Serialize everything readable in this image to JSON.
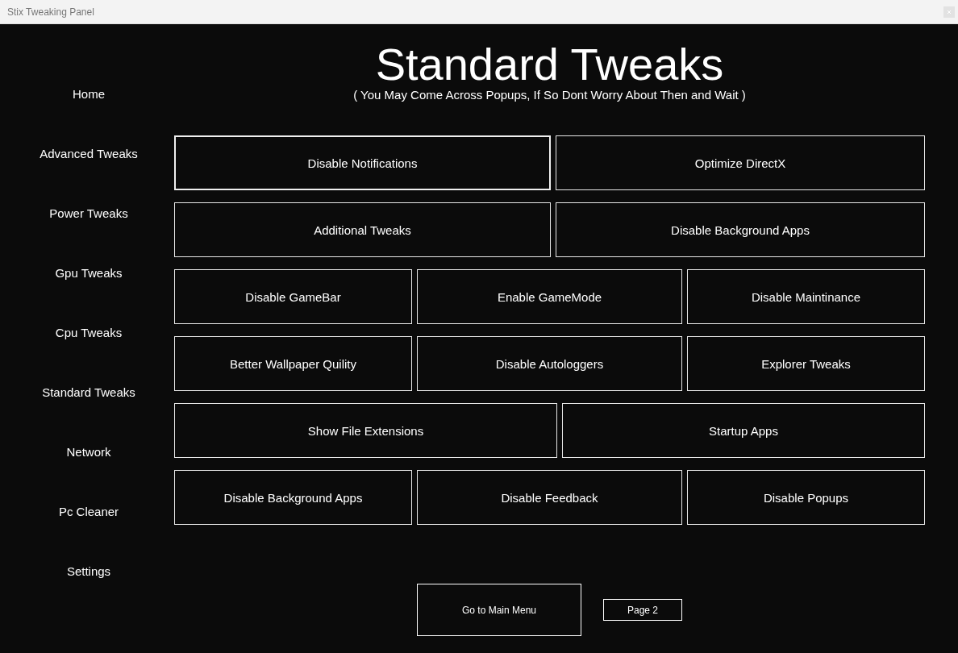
{
  "window": {
    "title": "Stix Tweaking Panel"
  },
  "sidebar": {
    "items": [
      {
        "label": "Home"
      },
      {
        "label": "Advanced Tweaks"
      },
      {
        "label": "Power Tweaks"
      },
      {
        "label": "Gpu Tweaks"
      },
      {
        "label": "Cpu Tweaks"
      },
      {
        "label": "Standard Tweaks"
      },
      {
        "label": "Network"
      },
      {
        "label": "Pc Cleaner"
      },
      {
        "label": "Settings"
      }
    ]
  },
  "header": {
    "title": "Standard Tweaks",
    "subtitle": "( You May Come Across Popups, If So Dont Worry About Then and Wait )"
  },
  "rows": [
    {
      "buttons": [
        {
          "label": "Disable Notifications",
          "focused": true
        },
        {
          "label": "Optimize DirectX",
          "focused": false
        }
      ]
    },
    {
      "buttons": [
        {
          "label": "Additional Tweaks",
          "focused": false
        },
        {
          "label": "Disable Background Apps",
          "focused": false
        }
      ]
    },
    {
      "buttons": [
        {
          "label": "Disable GameBar",
          "focused": false
        },
        {
          "label": "Enable GameMode",
          "focused": false
        },
        {
          "label": "Disable Maintinance",
          "focused": false
        }
      ]
    },
    {
      "buttons": [
        {
          "label": "Better Wallpaper Quility",
          "focused": false
        },
        {
          "label": "Disable Autologgers",
          "focused": false
        },
        {
          "label": "Explorer Tweaks",
          "focused": false
        }
      ]
    },
    {
      "buttons": [
        {
          "label": "Show File Extensions",
          "focused": false
        },
        {
          "label": "Startup Apps",
          "focused": false
        }
      ]
    },
    {
      "buttons": [
        {
          "label": "Disable Background Apps",
          "focused": false
        },
        {
          "label": "Disable Feedback",
          "focused": false
        },
        {
          "label": "Disable Popups",
          "focused": false
        }
      ]
    }
  ],
  "footer": {
    "main_menu": "Go to Main Menu",
    "page": "Page 2"
  }
}
